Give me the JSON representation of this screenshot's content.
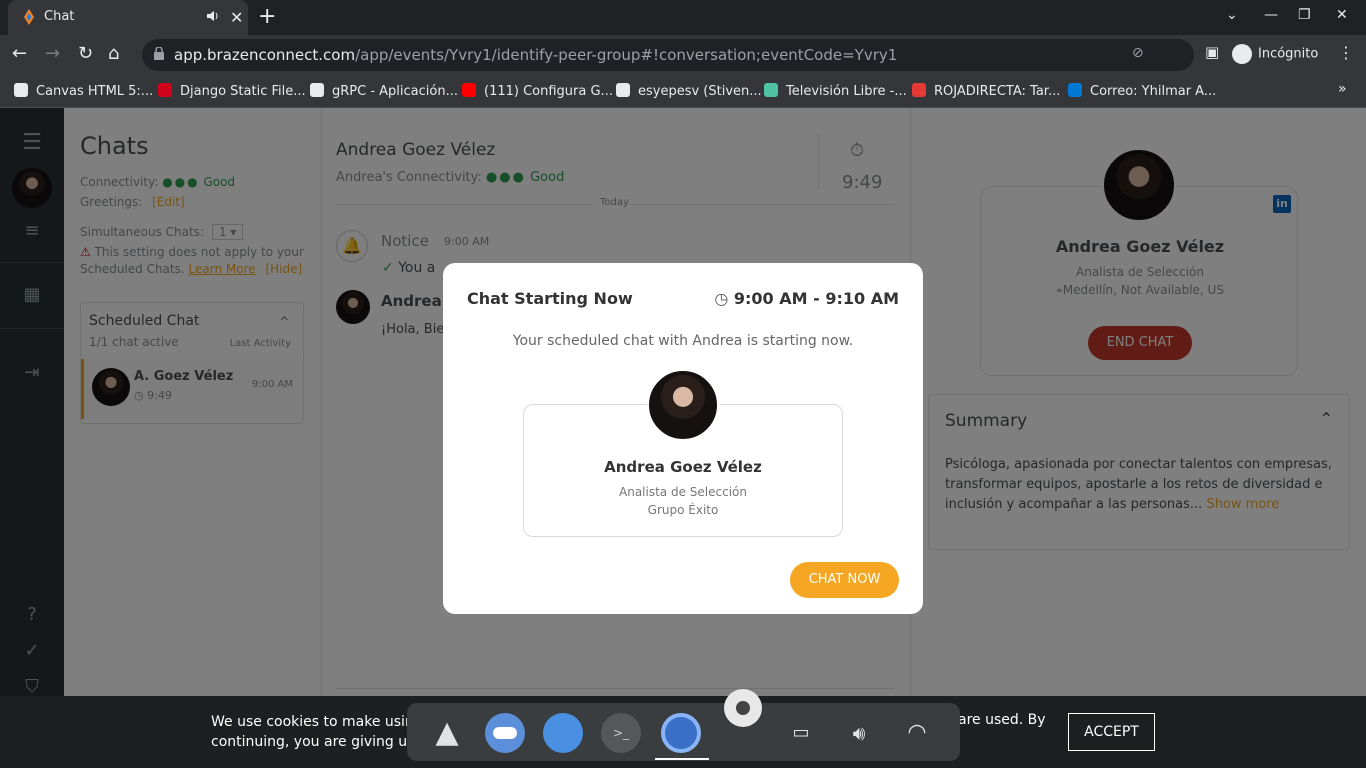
{
  "browser": {
    "tab_title": "Chat",
    "url_domain": "app.brazenconnect.com",
    "url_path": "/app/events/Yvry1/identify-peer-group#!conversation;eventCode=Yvry1",
    "incognito_label": "Incógnito",
    "bookmarks": [
      {
        "label": "Canvas HTML 5:...",
        "icon": "canvas-icon",
        "color": "#e8eaed"
      },
      {
        "label": "Django Static File...",
        "icon": "django-icon",
        "color": "#d0021b"
      },
      {
        "label": "gRPC - Aplicación...",
        "icon": "grpc-icon",
        "color": "#e8eaed"
      },
      {
        "label": "(111) Configura G...",
        "icon": "youtube-icon",
        "color": "#ff0000"
      },
      {
        "label": "esyepesv (Stiven...",
        "icon": "github-icon",
        "color": "#e8eaed"
      },
      {
        "label": "Televisión Libre -...",
        "icon": "tv-icon",
        "color": "#4fc3a1"
      },
      {
        "label": "ROJADIRECTA: Tar...",
        "icon": "rtv-icon",
        "color": "#e53935"
      },
      {
        "label": "Correo: Yhilmar A...",
        "icon": "outlook-icon",
        "color": "#0078d4"
      }
    ]
  },
  "chatlist": {
    "heading": "Chats",
    "connectivity_label": "Connectivity:",
    "connectivity_value": "Good",
    "greetings_label": "Greetings:",
    "greetings_edit": "[Edit]",
    "simultaneous_label": "Simultaneous Chats:",
    "simultaneous_value": "1",
    "warning": "This setting does not apply to your Scheduled Chats.",
    "learn_more": "Learn More",
    "hide": "[Hide]",
    "scheduled_title": "Scheduled Chat",
    "scheduled_active": "1/1 chat active",
    "last_activity": "Last Activity",
    "item_name": "A. Goez Vélez",
    "item_time": "9:49",
    "item_activity": "9:00 AM"
  },
  "conversation": {
    "name": "Andrea Goez Vélez",
    "connectivity_label": "Andrea's Connectivity:",
    "connectivity_value": "Good",
    "timer": "9:49",
    "day_divider": "Today",
    "notice_label": "Notice",
    "notice_time": "9:00 AM",
    "notice_text": "You a",
    "msg_name": "Andrea",
    "msg_text": "¡Hola, Bie"
  },
  "profile": {
    "name": "Andrea Goez Vélez",
    "title": "Analista de Selección",
    "location": "Medellín, Not Available, US",
    "end_chat": "END CHAT",
    "summary_title": "Summary",
    "summary_text": "Psicóloga, apasionada por conectar talentos con empresas, transformar equipos, apostarle a los retos de diversidad e inclusión y acompañar a las personas...",
    "show_more": "Show more"
  },
  "modal": {
    "title": "Chat Starting Now",
    "time_range": "9:00 AM - 9:10 AM",
    "subtitle": "Your scheduled chat with Andrea is starting now.",
    "card_name": "Andrea Goez Vélez",
    "card_role": "Analista de Selección",
    "card_company": "Grupo Éxito",
    "cta": "CHAT NOW"
  },
  "cookie": {
    "text_left": "We use cookies to make using",
    "text_left2": "continuing, you are giving us",
    "text_right": "are used. By",
    "accept": "ACCEPT"
  },
  "colors": {
    "accent": "#f5a623",
    "end_chat": "#c0392b",
    "good": "#2e9e50"
  }
}
